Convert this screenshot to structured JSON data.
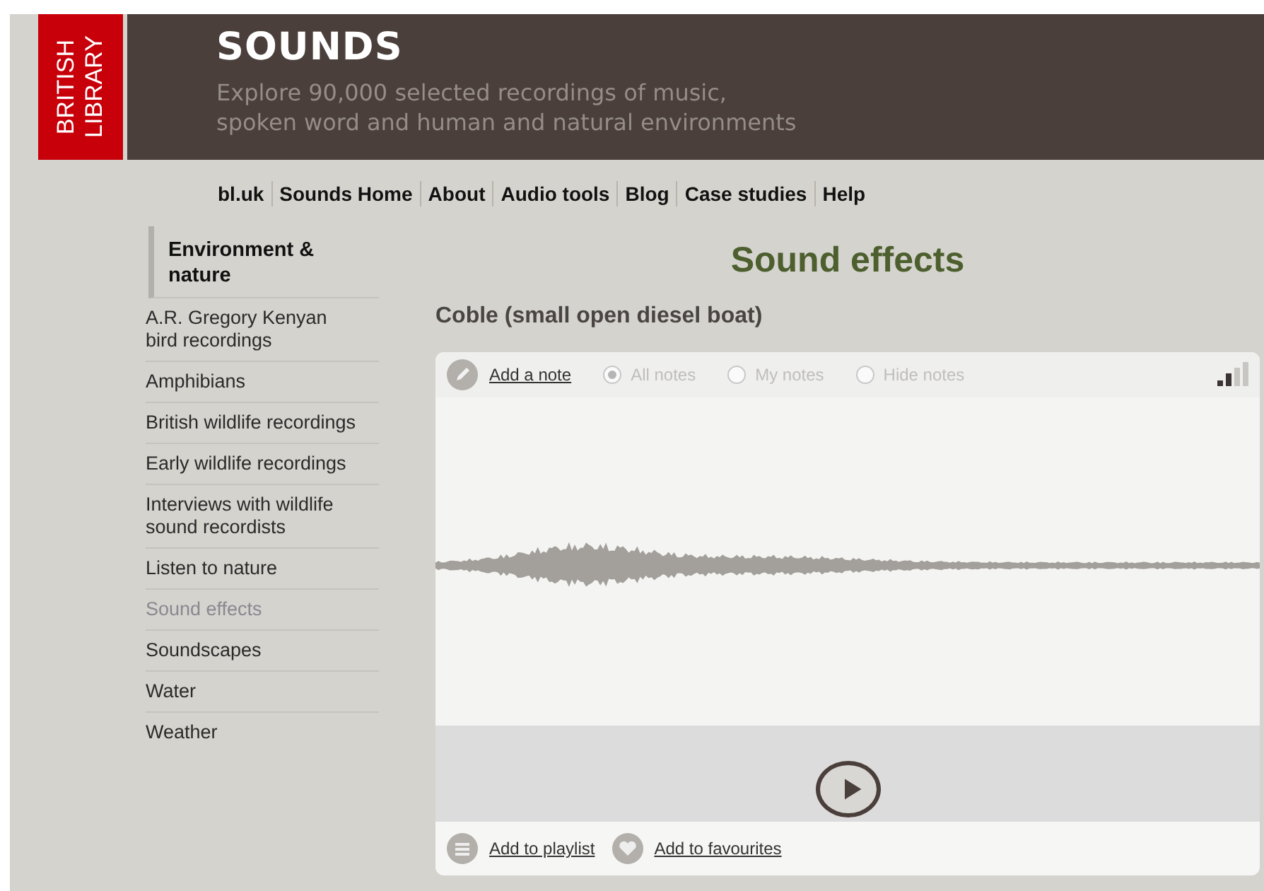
{
  "logo": {
    "lines": [
      "BRITISH",
      "LIBRARY"
    ]
  },
  "header": {
    "title": "SOUNDS",
    "tagline_lines": [
      "Explore 90,000 selected recordings of music,",
      "spoken word and human and natural environments"
    ]
  },
  "nav": [
    "bl.uk",
    "Sounds Home",
    "About",
    "Audio tools",
    "Blog",
    "Case studies",
    "Help"
  ],
  "sidebar": {
    "heading": "Environment & nature",
    "items": [
      {
        "label": "A.R. Gregory Kenyan bird recordings",
        "selected": false
      },
      {
        "label": "Amphibians",
        "selected": false
      },
      {
        "label": "British wildlife recordings",
        "selected": false
      },
      {
        "label": "Early wildlife recordings",
        "selected": false
      },
      {
        "label": "Interviews with wildlife sound recordists",
        "selected": false
      },
      {
        "label": "Listen to nature",
        "selected": false
      },
      {
        "label": "Sound effects",
        "selected": true
      },
      {
        "label": "Soundscapes",
        "selected": false
      },
      {
        "label": "Water",
        "selected": false
      },
      {
        "label": "Weather",
        "selected": false
      }
    ]
  },
  "page_title": "Sound effects",
  "recording_title": "Coble (small open diesel boat)",
  "player": {
    "add_note": "Add a note",
    "note_filters": [
      {
        "label": "All notes",
        "selected": true
      },
      {
        "label": "My notes",
        "selected": false
      },
      {
        "label": "Hide notes",
        "selected": false
      }
    ],
    "actions": [
      {
        "kind": "playlist",
        "label": "Add to playlist"
      },
      {
        "kind": "favourites",
        "label": "Add to favourites"
      }
    ]
  }
}
